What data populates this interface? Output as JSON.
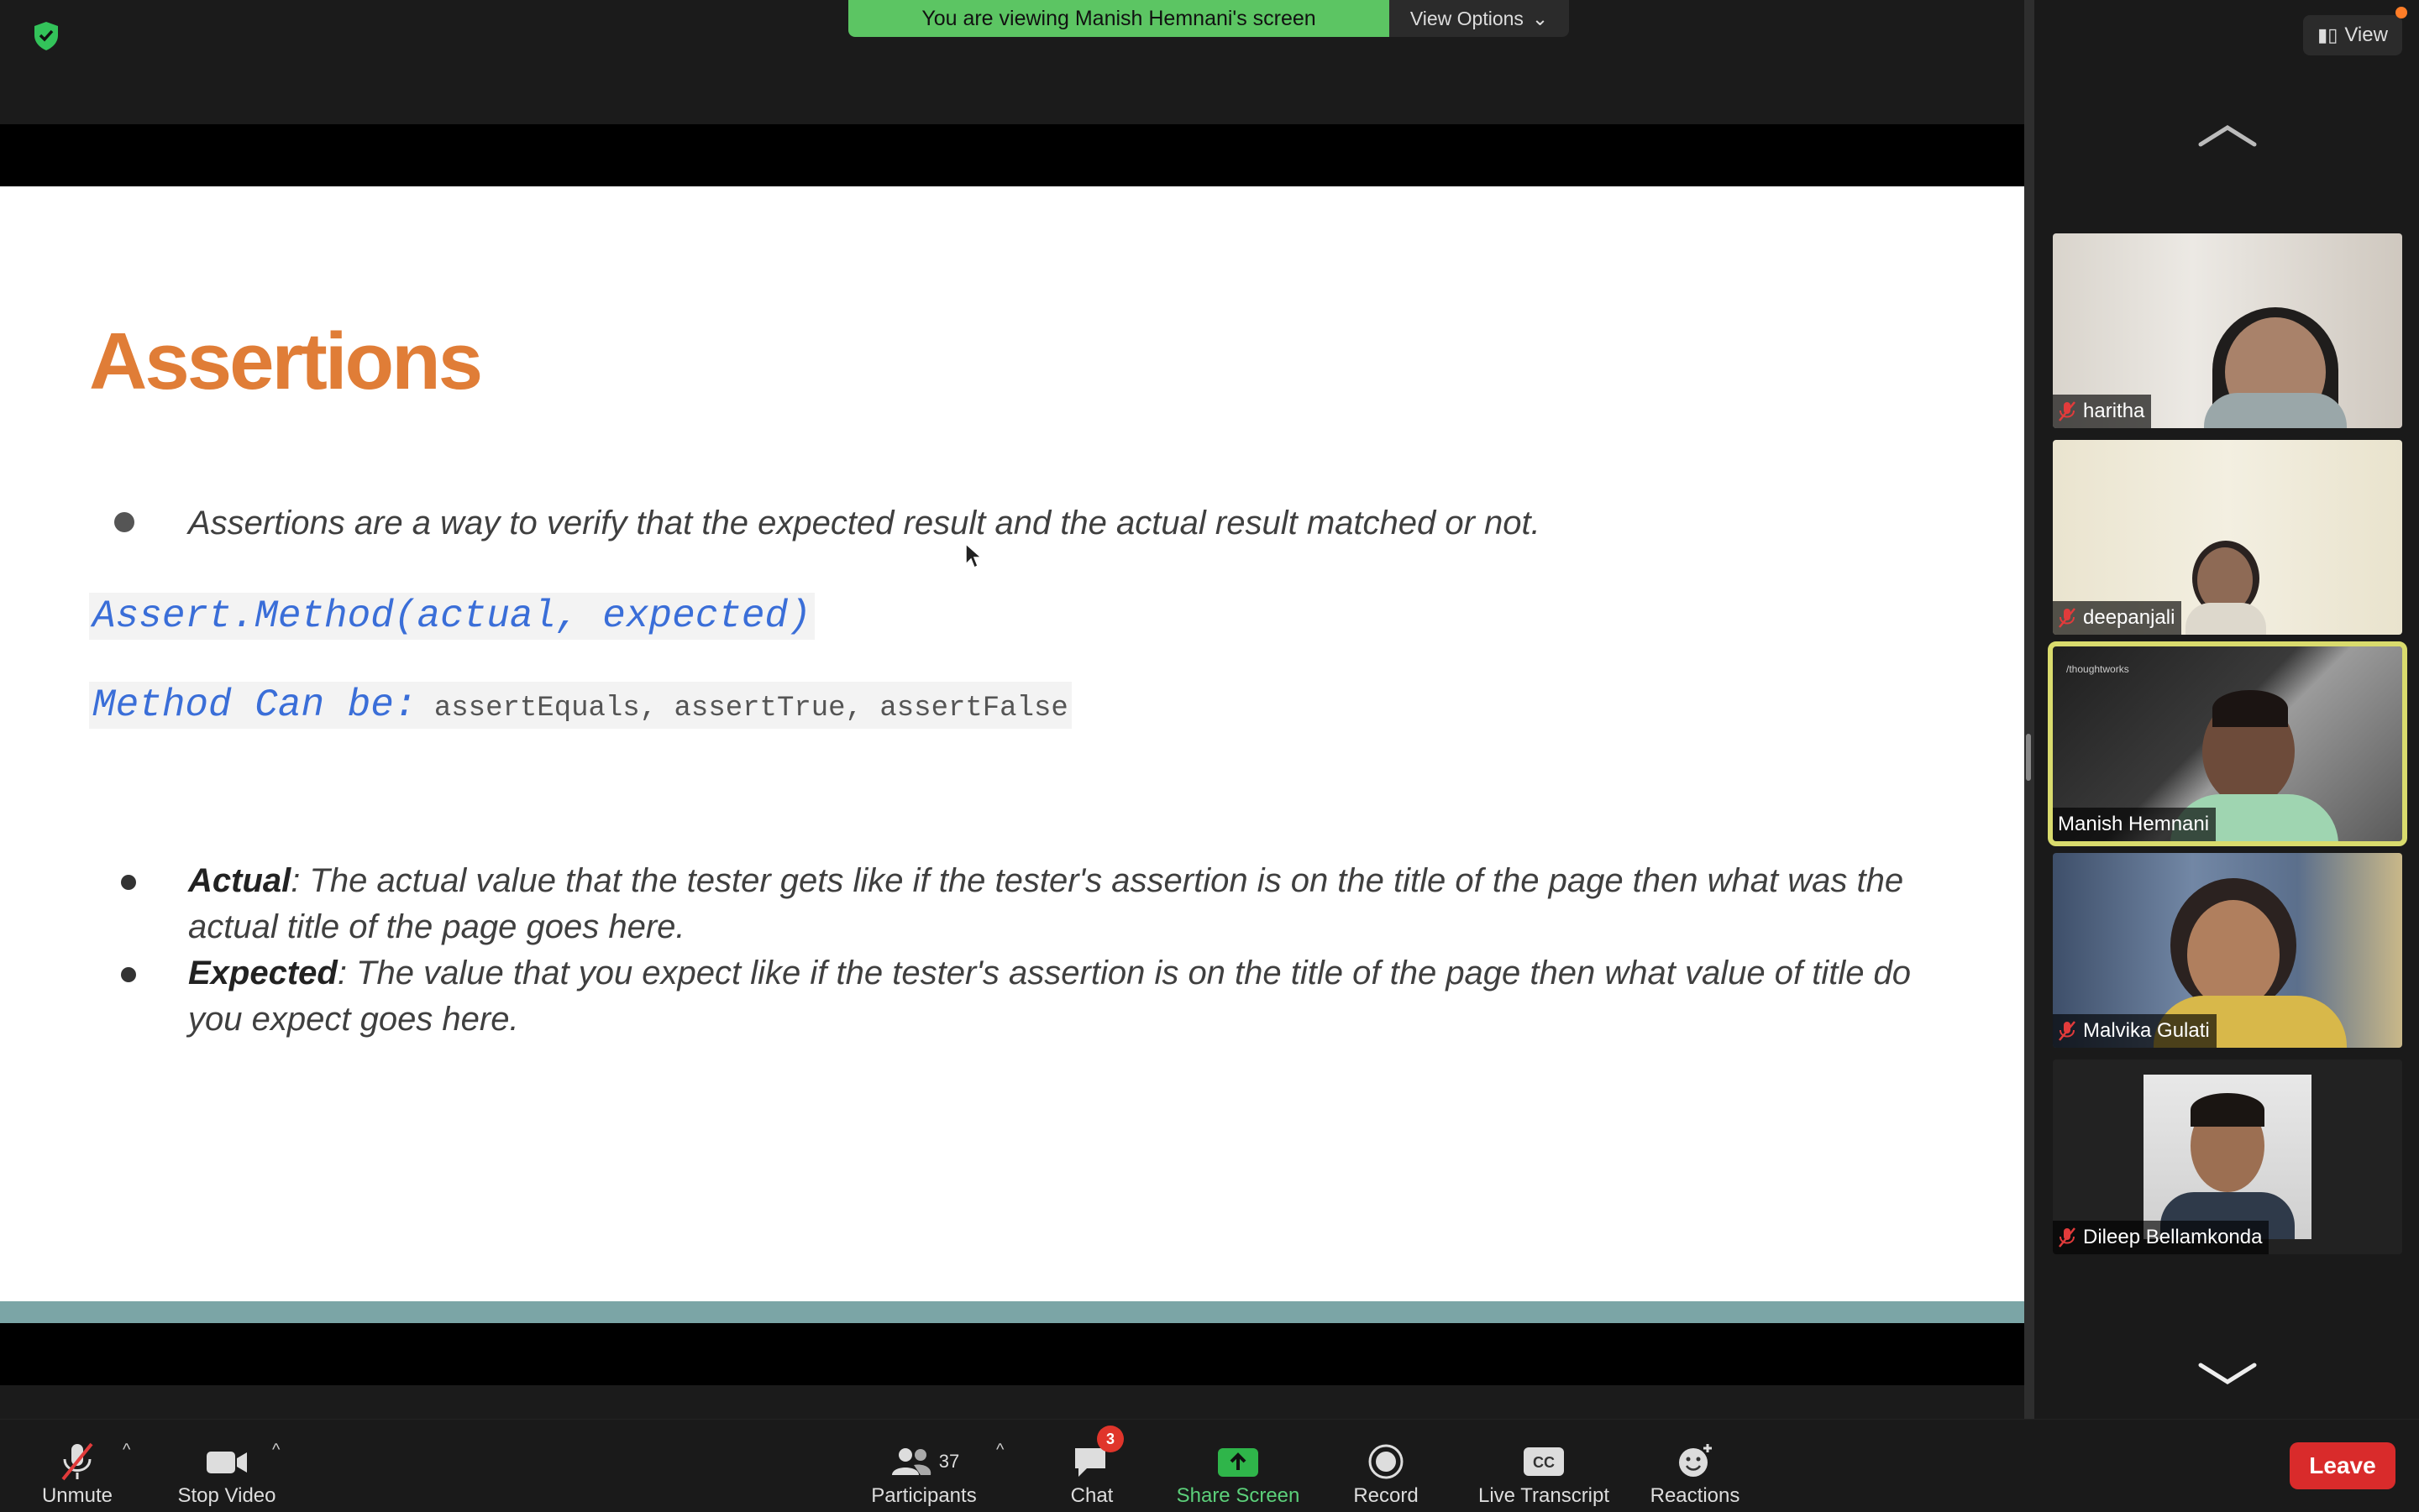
{
  "banner": {
    "text": "You are viewing Manish Hemnani's screen",
    "view_options": "View Options"
  },
  "slide": {
    "title": "Assertions",
    "bullet1": "Assertions are a way to verify that the expected result and the actual result matched or not.",
    "code_line1": "Assert.Method(actual, expected)",
    "code_line2_label": "Method Can be:",
    "code_line2_methods": " assertEquals, assertTrue, assertFalse",
    "bullet2_term": "Actual",
    "bullet2_text": ": The actual value that the tester gets like if the tester's assertion is on the title of the page then what was the actual title of the page goes here.",
    "bullet3_term": "Expected",
    "bullet3_text": ": The value that you expect like if the tester's assertion is on the title of the page then what value of title do you expect goes here."
  },
  "right_panel": {
    "view_label": "View",
    "participants": [
      {
        "name": "haritha",
        "muted": true
      },
      {
        "name": "deepanjali",
        "muted": true
      },
      {
        "name": "Manish Hemnani",
        "muted": false,
        "active_speaker": true
      },
      {
        "name": "Malvika Gulati",
        "muted": true
      },
      {
        "name": "Dileep Bellamkonda",
        "muted": true
      }
    ]
  },
  "toolbar": {
    "unmute": "Unmute",
    "stop_video": "Stop Video",
    "participants": "Participants",
    "participants_count": "37",
    "chat": "Chat",
    "chat_badge": "3",
    "share_screen": "Share Screen",
    "record": "Record",
    "live_transcript": "Live Transcript",
    "reactions": "Reactions",
    "leave": "Leave"
  },
  "colors": {
    "banner_green": "#5cc563",
    "leave_red": "#d92b2b",
    "active_speaker_border": "#d9db6d",
    "slide_title": "#e07d37",
    "code_blue": "#3a6ed8"
  }
}
